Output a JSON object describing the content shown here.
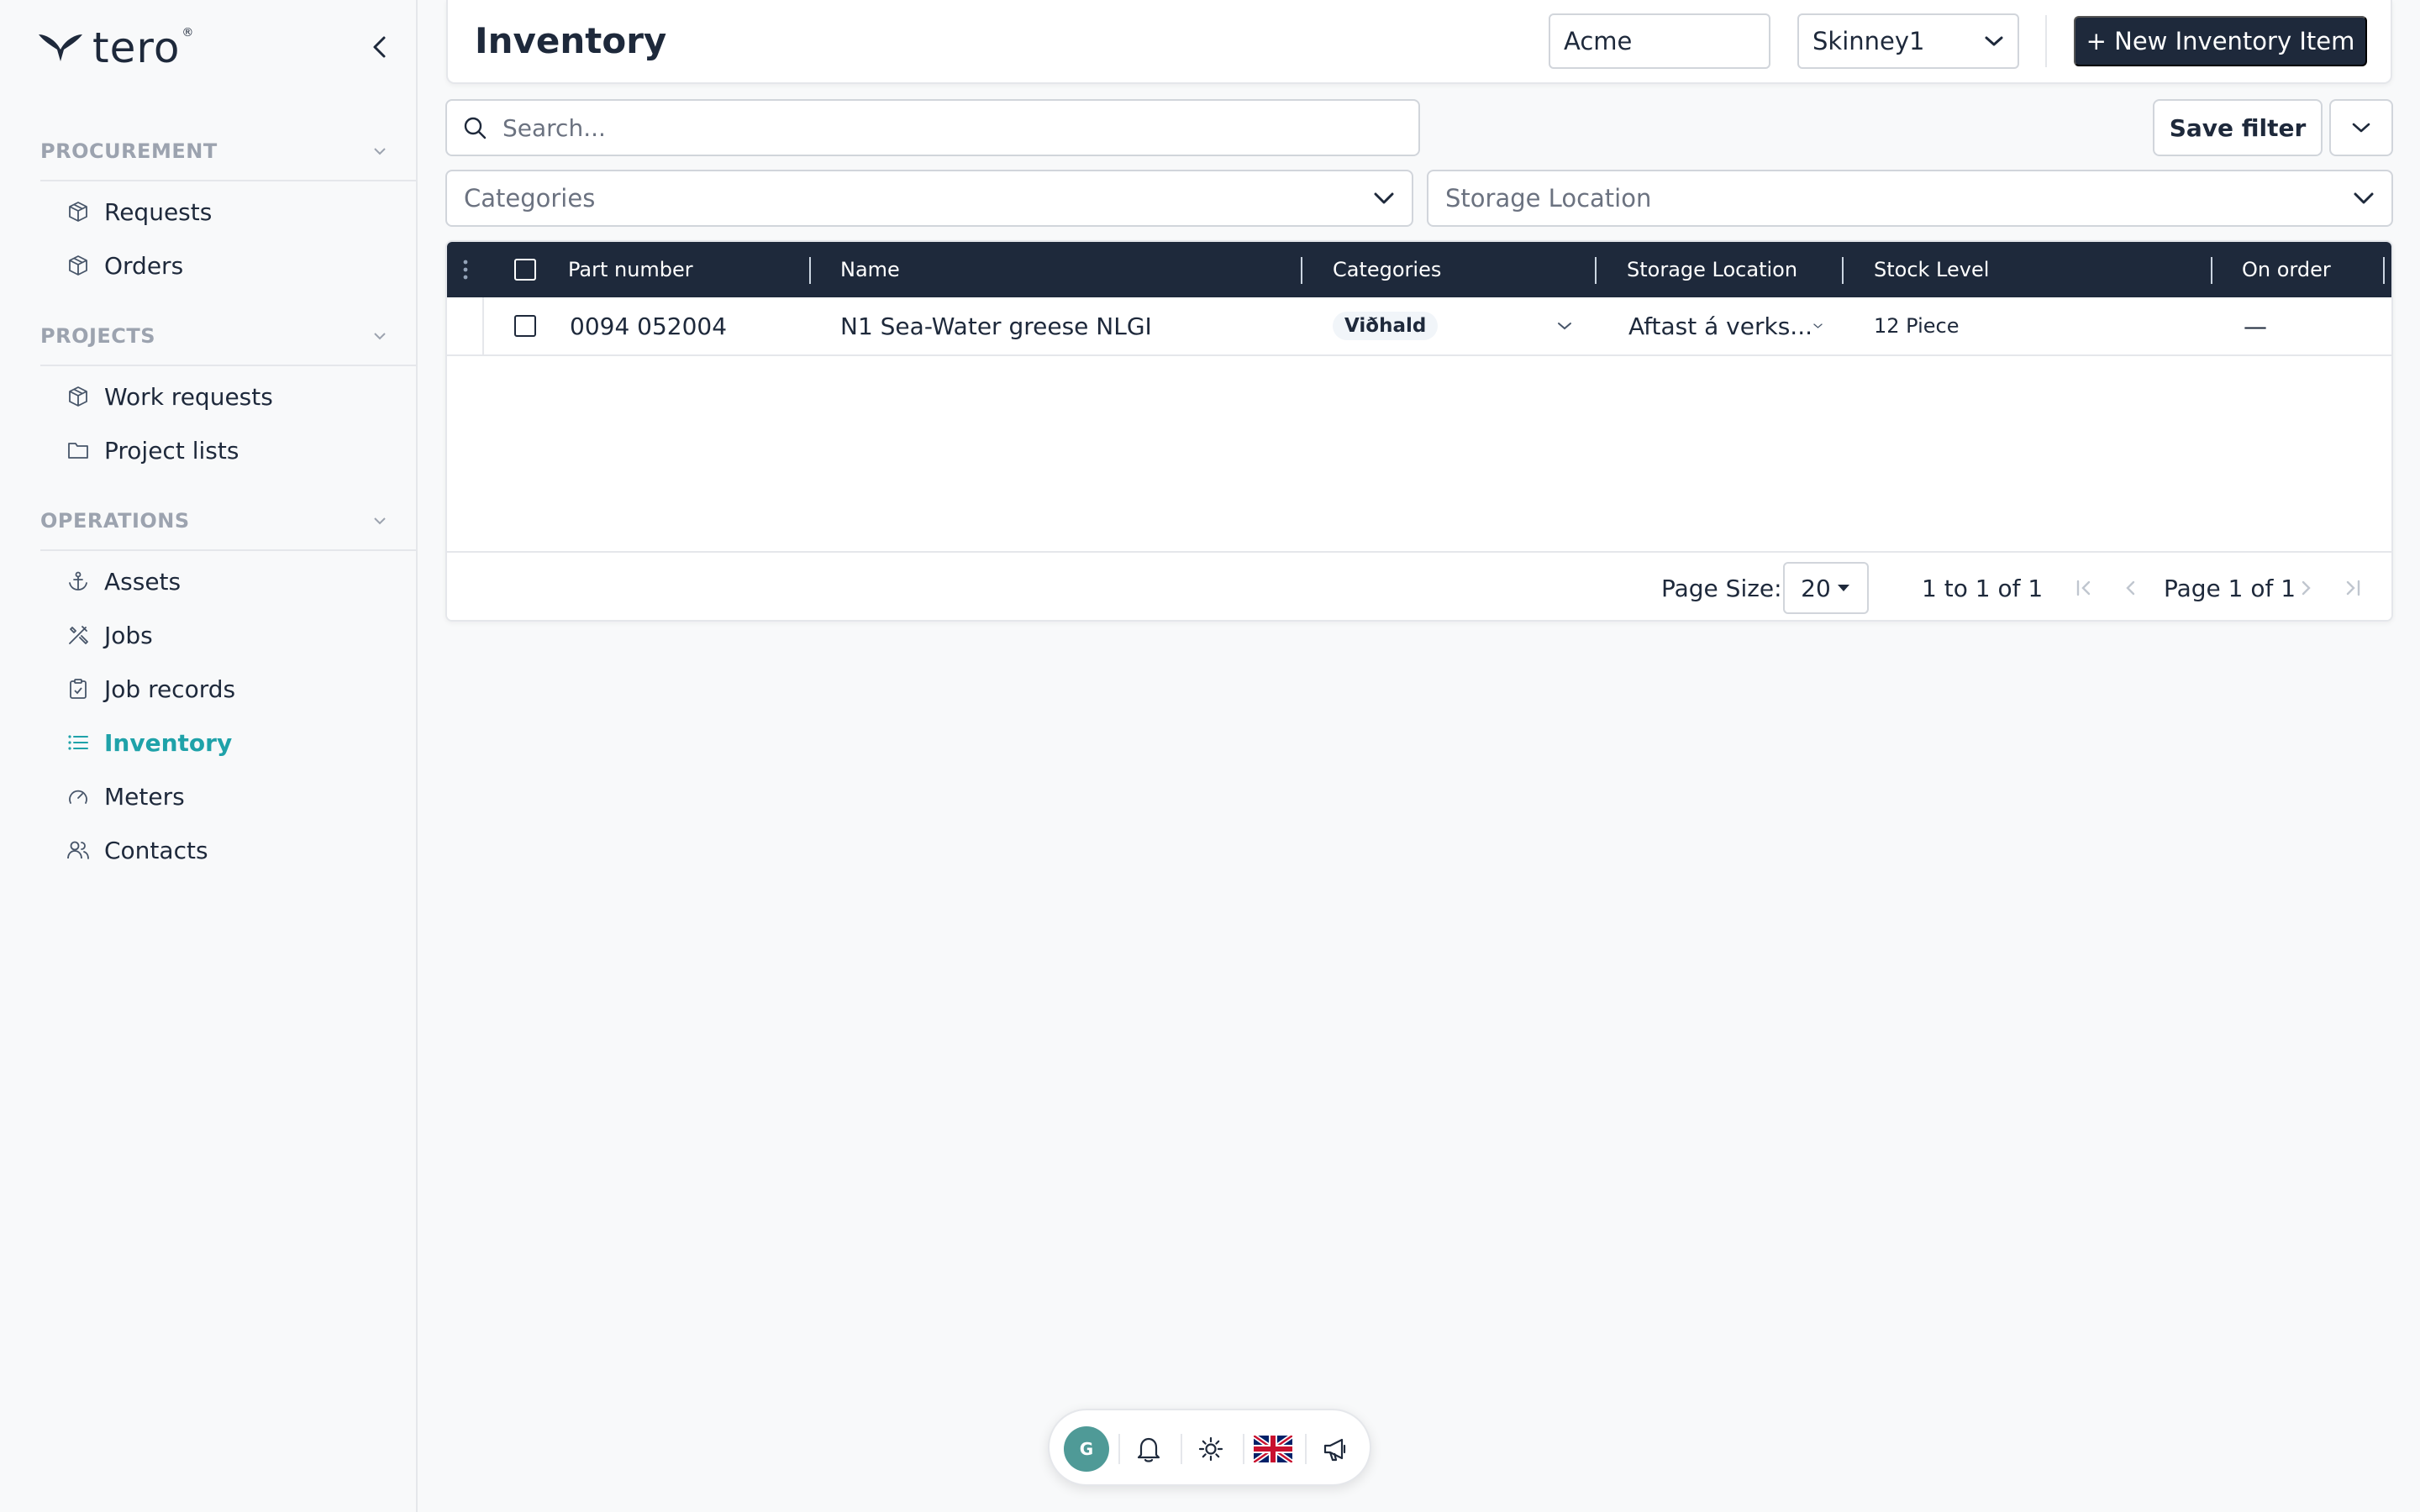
{
  "app": {
    "brand": "tero"
  },
  "sidebar": {
    "sections": [
      {
        "label": "PROCUREMENT",
        "items": [
          {
            "label": "Requests",
            "icon": "box-icon"
          },
          {
            "label": "Orders",
            "icon": "box-icon"
          }
        ]
      },
      {
        "label": "PROJECTS",
        "items": [
          {
            "label": "Work requests",
            "icon": "box-icon"
          },
          {
            "label": "Project lists",
            "icon": "folder-icon"
          }
        ]
      },
      {
        "label": "OPERATIONS",
        "items": [
          {
            "label": "Assets",
            "icon": "anchor-icon"
          },
          {
            "label": "Jobs",
            "icon": "tools-icon"
          },
          {
            "label": "Job records",
            "icon": "clipboard-icon"
          },
          {
            "label": "Inventory",
            "icon": "list-icon",
            "active": true
          },
          {
            "label": "Meters",
            "icon": "gauge-icon"
          },
          {
            "label": "Contacts",
            "icon": "users-icon"
          }
        ]
      }
    ],
    "active_color": "#1fa2a9"
  },
  "header": {
    "title": "Inventory",
    "company_value": "Acme",
    "vessel_value": "Skinney1",
    "new_button": "+ New Inventory Item"
  },
  "filters": {
    "search_placeholder": "Search...",
    "save_filter": "Save filter",
    "categories_placeholder": "Categories",
    "storage_placeholder": "Storage Location"
  },
  "table": {
    "columns": [
      "Part number",
      "Name",
      "Categories",
      "Storage Location",
      "Stock Level",
      "On order"
    ],
    "rows": [
      {
        "part_number": "0094 052004",
        "name": "N1 Sea-Water greese NLGI",
        "category": "Viðhald",
        "storage": "Aftast á verks...",
        "stock": "12 Piece",
        "on_order": "—"
      }
    ],
    "header_color": "#1e293b"
  },
  "pagination": {
    "page_size_label": "Page Size:",
    "page_size": "20",
    "range": "1 to 1 of 1",
    "page_info": "Page 1 of 1"
  },
  "bottombar": {
    "avatar_initial": "G",
    "icons": [
      "bell-icon",
      "sun-icon",
      "uk-flag-icon",
      "megaphone-icon"
    ]
  }
}
